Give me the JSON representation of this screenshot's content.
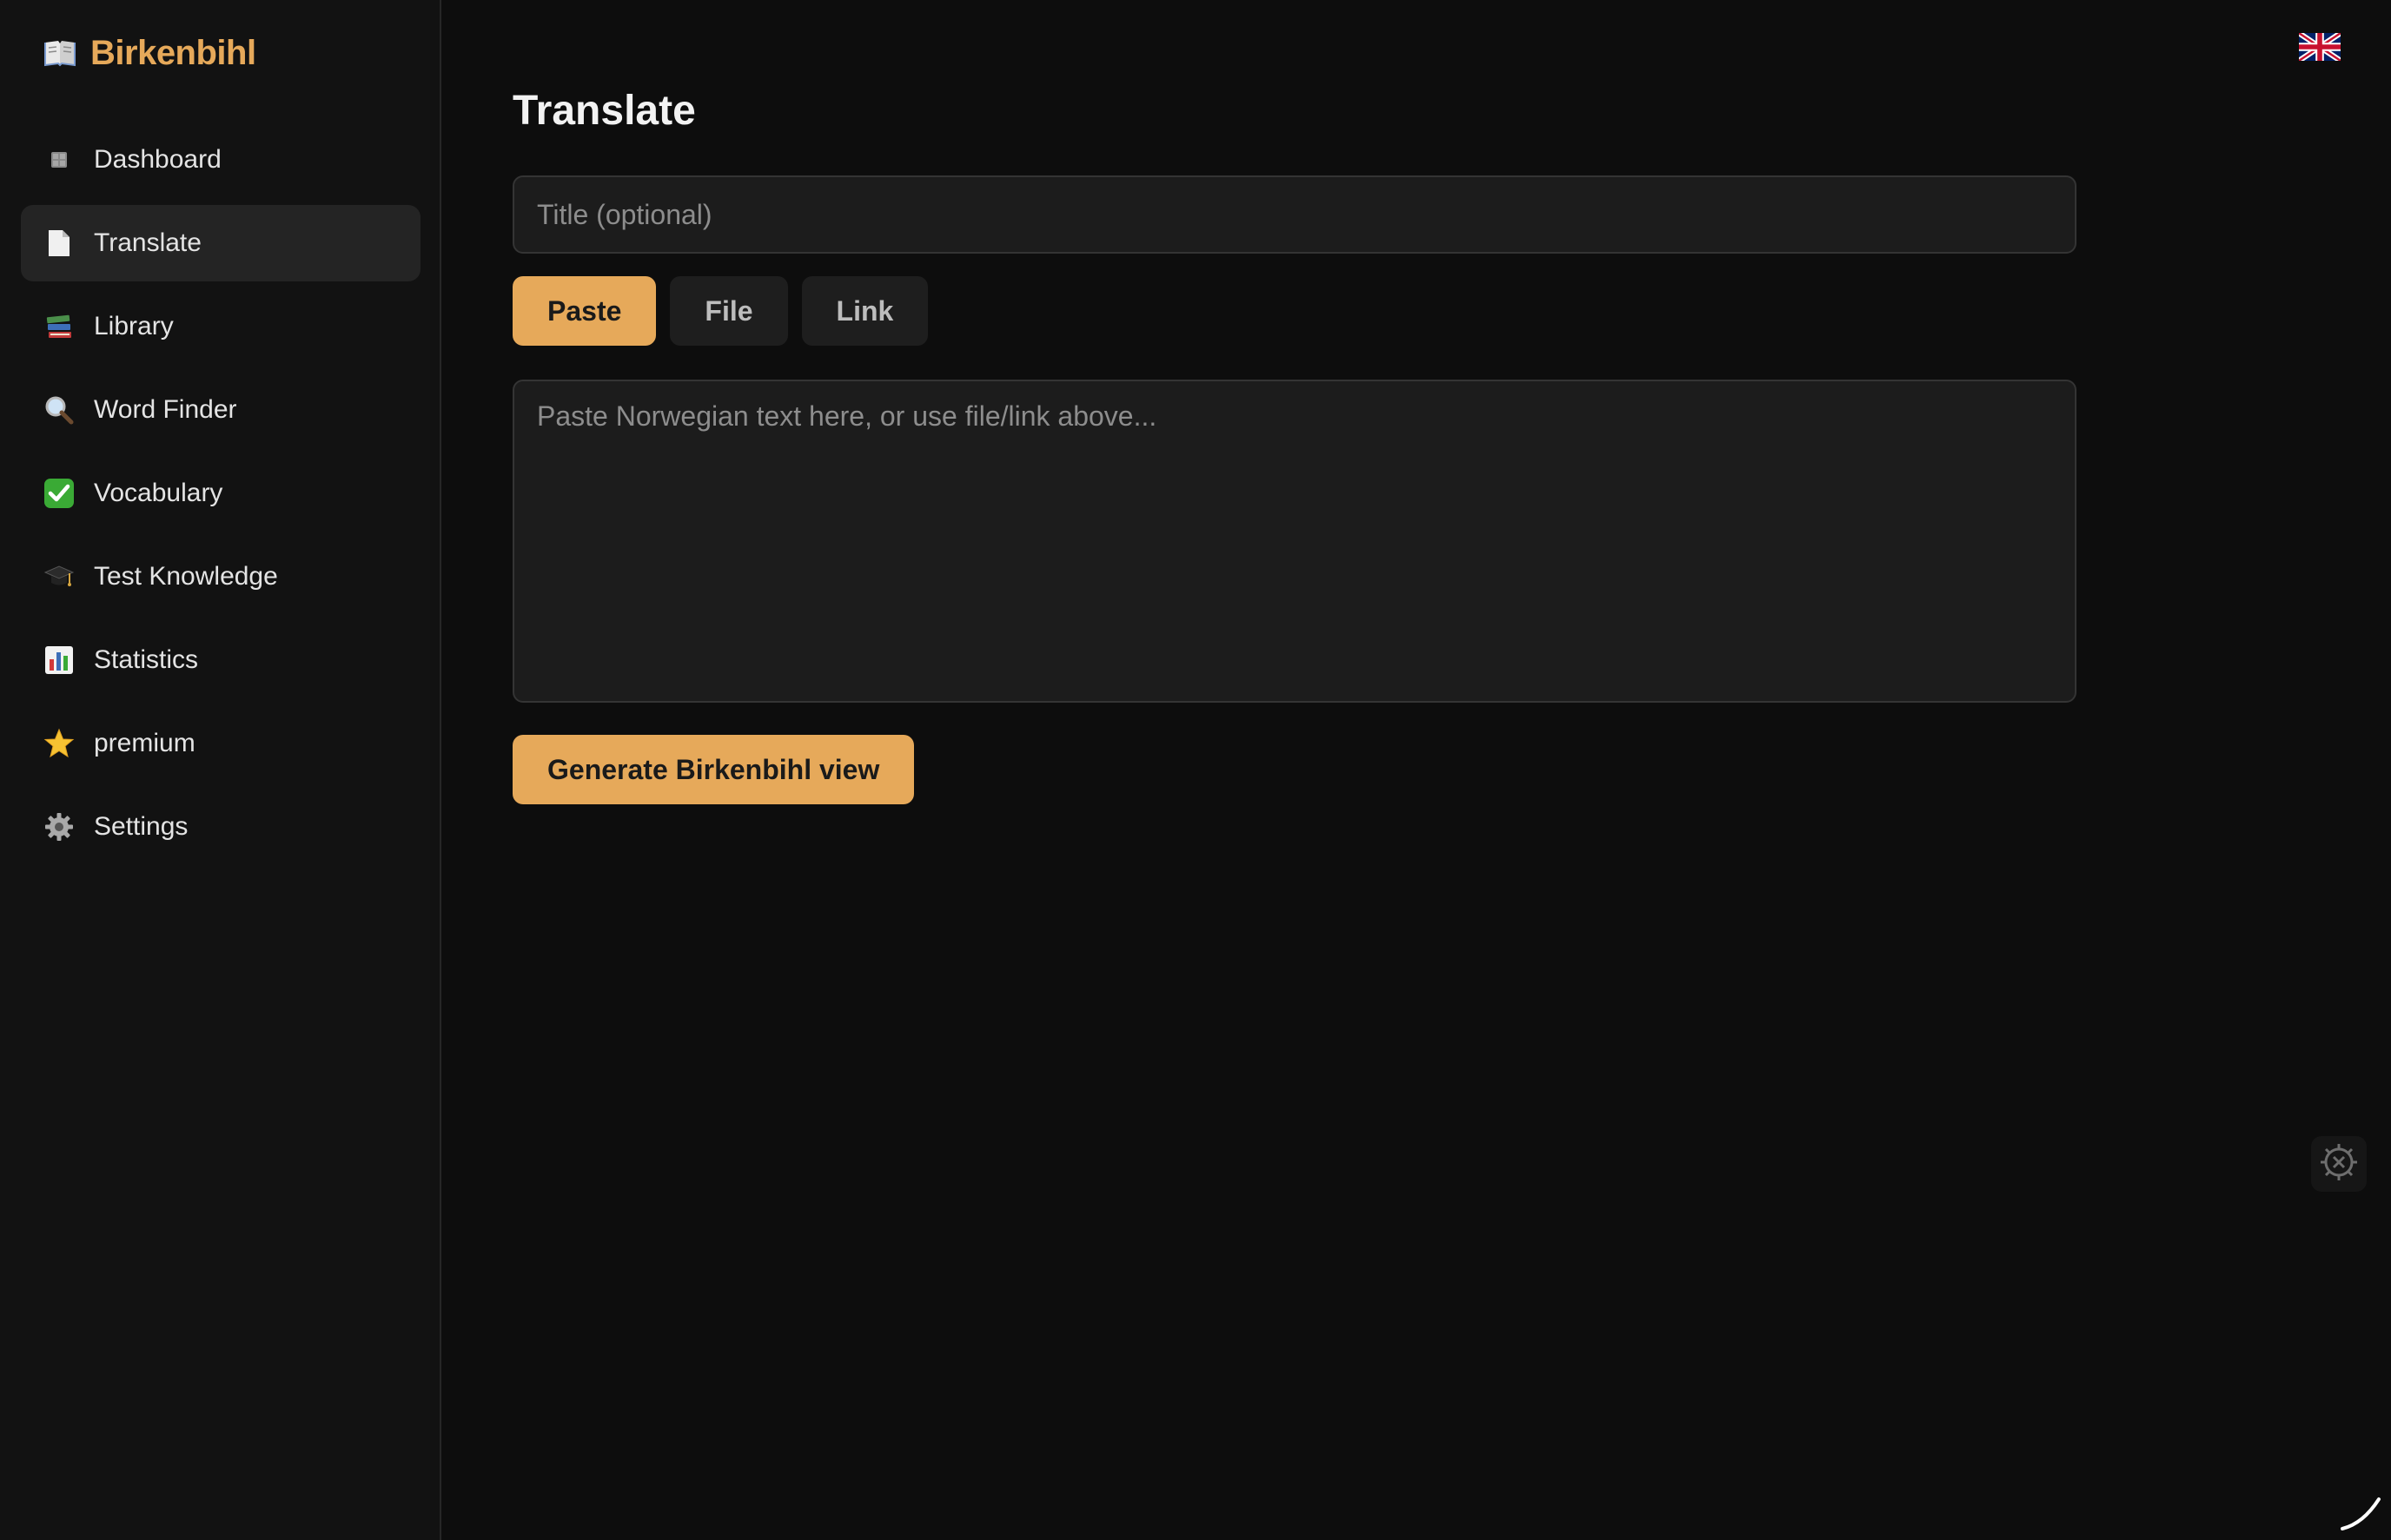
{
  "app": {
    "brand": "Birkenbihl",
    "brand_icon": "open-book-icon"
  },
  "sidebar": {
    "items": [
      {
        "label": "Dashboard",
        "icon": "dashboard-icon",
        "active": false
      },
      {
        "label": "Translate",
        "icon": "document-icon",
        "active": true
      },
      {
        "label": "Library",
        "icon": "books-icon",
        "active": false
      },
      {
        "label": "Word Finder",
        "icon": "magnifier-icon",
        "active": false
      },
      {
        "label": "Vocabulary",
        "icon": "check-mark-icon",
        "active": false
      },
      {
        "label": "Test Knowledge",
        "icon": "graduation-cap-icon",
        "active": false
      },
      {
        "label": "Statistics",
        "icon": "bar-chart-icon",
        "active": false
      },
      {
        "label": "premium",
        "icon": "star-icon",
        "active": false
      },
      {
        "label": "Settings",
        "icon": "gear-icon",
        "active": false
      }
    ]
  },
  "main": {
    "title": "Translate",
    "title_input": {
      "placeholder": "Title (optional)",
      "value": ""
    },
    "tabs": [
      {
        "label": "Paste",
        "active": true
      },
      {
        "label": "File",
        "active": false
      },
      {
        "label": "Link",
        "active": false
      }
    ],
    "text_input": {
      "placeholder": "Paste Norwegian text here, or use file/link above...",
      "value": ""
    },
    "generate_label": "Generate Birkenbihl view"
  },
  "header": {
    "language_flag": "uk-flag-icon"
  },
  "colors": {
    "accent": "#e6a95a",
    "background": "#0d0d0d",
    "sidebar_bg": "#121212",
    "input_bg": "#1c1c1c"
  }
}
